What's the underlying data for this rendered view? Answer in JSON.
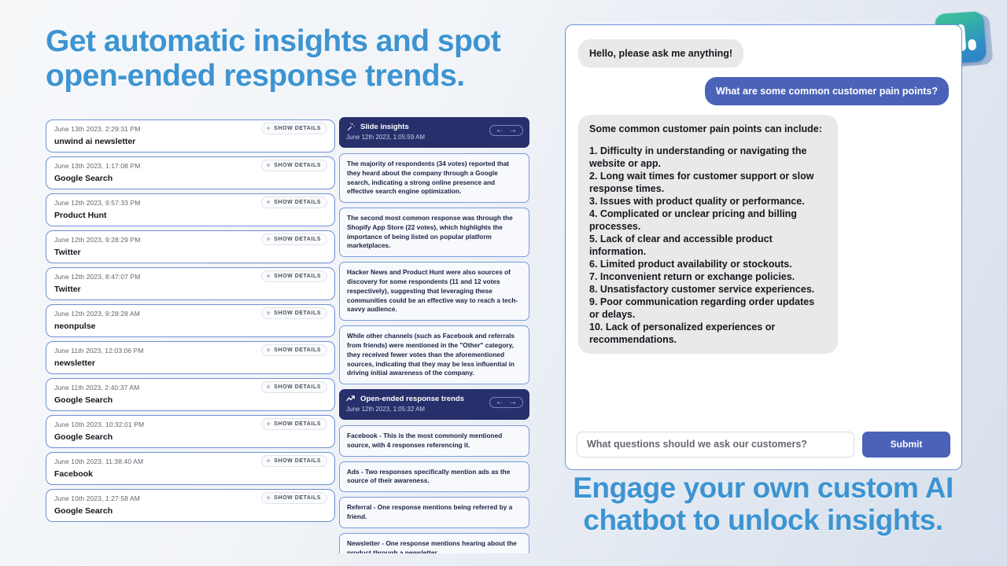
{
  "headlines": {
    "top": "Get automatic insights and spot open-ended response trends.",
    "bottom": "Engage your own custom AI chatbot to unlock insights."
  },
  "logo": {
    "name": "app-logo-bar-chart",
    "gradient_from": "#3fc29a",
    "gradient_to": "#2f7fc8"
  },
  "responses_panel": {
    "show_details_label": "SHOW DETAILS",
    "plus_icon": "+",
    "items": [
      {
        "time": "June 13th 2023, 2:29:31 PM",
        "label": "unwind ai newsletter"
      },
      {
        "time": "June 13th 2023, 1:17:08 PM",
        "label": "Google Search"
      },
      {
        "time": "June 12th 2023, 9:57:33 PM",
        "label": "Product Hunt"
      },
      {
        "time": "June 12th 2023, 9:28:29 PM",
        "label": "Twitter"
      },
      {
        "time": "June 12th 2023, 8:47:07 PM",
        "label": "Twitter"
      },
      {
        "time": "June 12th 2023, 9:28:28 AM",
        "label": "neonpulse"
      },
      {
        "time": "June 11th 2023, 12:03:06 PM",
        "label": "newsletter"
      },
      {
        "time": "June 11th 2023, 2:40:37 AM",
        "label": "Google Search"
      },
      {
        "time": "June 10th 2023, 10:32:01 PM",
        "label": "Google Search"
      },
      {
        "time": "June 10th 2023, 11:38:40 AM",
        "label": "Facebook"
      },
      {
        "time": "June 10th 2023, 1:27:58 AM",
        "label": "Google Search"
      }
    ]
  },
  "insights_panel": {
    "slide_insights": {
      "icon": "magic-wand-icon",
      "title": "Slide insights",
      "date": "June 12th 2023, 1:05:59 AM",
      "prev_arrow": "←",
      "next_arrow": "→",
      "cards": [
        "The majority of respondents (34 votes) reported that they heard about the company through a Google search, indicating a strong online presence and effective search engine optimization.",
        "The second most common response was through the Shopify App Store (22 votes), which highlights the importance of being listed on popular platform marketplaces.",
        "Hacker News and Product Hunt were also sources of discovery for some respondents (11 and 12 votes respectively), suggesting that leveraging these communities could be an effective way to reach a tech-savvy audience.",
        "While other channels (such as Facebook and referrals from friends) were mentioned in the \"Other\" category, they received fewer votes than the aforementioned sources, indicating that they may be less influential in driving initial awareness of the company."
      ]
    },
    "open_ended_trends": {
      "icon": "trend-up-icon",
      "title": "Open-ended response trends",
      "date": "June 12th 2023, 1:05:32 AM",
      "prev_arrow": "←",
      "next_arrow": "→",
      "cards": [
        "Facebook - This is the most commonly mentioned source, with 4 responses referencing it.",
        "Ads - Two responses specifically mention ads as the source of their awareness.",
        "Referral - One response mentions being referred by a friend.",
        "Newsletter - One response mentions hearing about the product through a newsletter."
      ]
    }
  },
  "chat": {
    "messages": [
      {
        "role": "bot",
        "text": "Hello, please ask me anything!"
      },
      {
        "role": "user",
        "text": "What are some common customer pain points?"
      }
    ],
    "answer_intro": "Some common customer pain points can include:",
    "answer_items": [
      "1. Difficulty in understanding or navigating the website or app.",
      "2. Long wait times for customer support or slow response times.",
      "3. Issues with product quality or performance.",
      "4. Complicated or unclear pricing and billing processes.",
      "5. Lack of clear and accessible product information.",
      "6. Limited product availability or stockouts.",
      "7. Inconvenient return or exchange policies.",
      "8. Unsatisfactory customer service experiences.",
      "9. Poor communication regarding order updates or delays.",
      "10. Lack of personalized experiences or recommendations."
    ],
    "input_placeholder": "What questions should we ask our customers?",
    "submit_label": "Submit"
  },
  "colors": {
    "headline_blue": "#3d94d1",
    "accent_blue": "#4a62b8",
    "dark_navy": "#27306b",
    "card_border": "#6f8fd4"
  }
}
